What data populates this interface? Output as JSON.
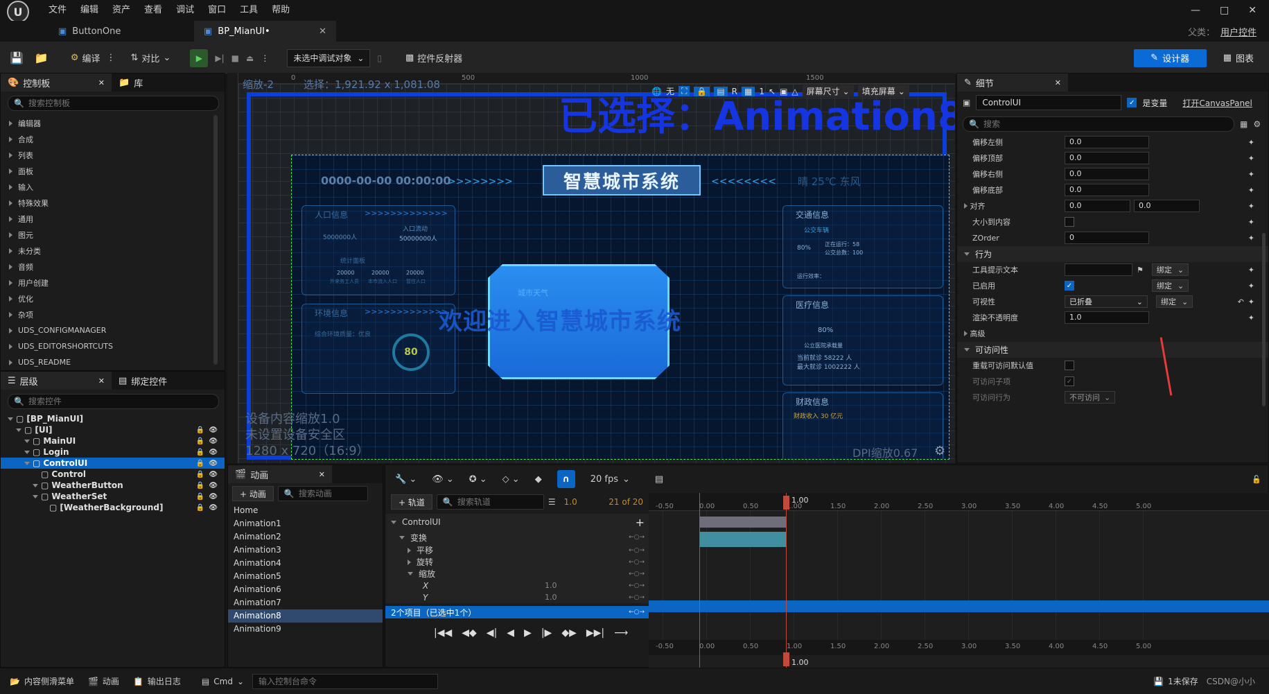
{
  "app": {
    "logo": "unreal-engine-logo"
  },
  "menu": [
    "文件",
    "编辑",
    "资产",
    "查看",
    "调试",
    "窗口",
    "工具",
    "帮助"
  ],
  "window": {
    "parent_label": "父类：",
    "parent_value": "用户控件"
  },
  "tabs": [
    {
      "label": "ButtonOne"
    },
    {
      "label": "BP_MianUI•"
    }
  ],
  "toolbar": {
    "compile": "编译",
    "diff": "对比",
    "debug_select": "未选中调试对象",
    "widget_reflector": "控件反射器",
    "designer": "设计器",
    "graph": "图表"
  },
  "palette": {
    "tab_palette": "控制板",
    "tab_library": "库",
    "search_placeholder": "搜索控制板",
    "items": [
      "编辑器",
      "合成",
      "列表",
      "面板",
      "输入",
      "特殊效果",
      "通用",
      "图元",
      "未分类",
      "音频",
      "用户创建",
      "优化",
      "杂项",
      "UDS_CONFIGMANAGER",
      "UDS_EDITORSHORTCUTS",
      "UDS_README"
    ]
  },
  "hierarchy": {
    "tab_hierarchy": "层级",
    "tab_bind": "绑定控件",
    "search_placeholder": "搜索控件",
    "items": [
      {
        "label": "[BP_MianUI]",
        "depth": 0
      },
      {
        "label": "[UI]",
        "depth": 1
      },
      {
        "label": "MainUI",
        "depth": 2
      },
      {
        "label": "Login",
        "depth": 2
      },
      {
        "label": "ControlUI",
        "depth": 2,
        "selected": true
      },
      {
        "label": "Control",
        "depth": 3
      },
      {
        "label": "WeatherButton",
        "depth": 3
      },
      {
        "label": "WeatherSet",
        "depth": 3
      },
      {
        "label": "[WeatherBackground]",
        "depth": 4
      }
    ]
  },
  "canvas": {
    "zoom": "缩放-2",
    "selection": "选择：1,921.92 x 1,081.08",
    "selected_banner": "已选择：Animation8",
    "ruler_marks": [
      "0",
      "500",
      "1000",
      "1500"
    ],
    "ruler_v_marks": [
      "0",
      "5",
      "5",
      "0"
    ],
    "device_scale": "设备内容缩放1.0",
    "safe_zone": "未设置设备安全区",
    "resolution": "1280 x 720（16:9）",
    "dpi": "DPI缩放0.67",
    "toolbar": {
      "none": "无",
      "r": "R",
      "one": "1",
      "screen_size": "屏幕尺寸",
      "fill_screen": "填充屏幕"
    },
    "ui_title": "智慧城市系统",
    "ui_datetime": "0000-00-00    00:00:00",
    "ui_weather": "晴    25℃    东风",
    "ui_welcome": "欢迎进入智慧城市系统",
    "ui_population": "人口信息",
    "ui_pop_daily": "入口流动",
    "ui_pop_total": "5000000人",
    "ui_pop_total2": "50000000人",
    "ui_pop_stats_title": "统计面板",
    "ui_pop_vals": [
      "20000",
      "20000",
      "20000"
    ],
    "ui_pop_labels": [
      "外来务工人员",
      "本市流入人口",
      "暂住人口"
    ],
    "ui_env": "环境信息",
    "ui_env_quality": "综合环境质量：优良",
    "ui_env_score": "80",
    "ui_traffic": "交通信息",
    "ui_traffic_bus": "公交车辆",
    "ui_traffic_running": "正在运行：58",
    "ui_traffic_total": "公交总数：100",
    "ui_traffic_pct": "80%",
    "ui_traffic_efficiency": "运行效率：",
    "ui_medical": "医疗信息",
    "ui_medical_hospital": "公立医院承载量",
    "ui_medical_current": "当前就诊 58222 人",
    "ui_medical_max": "最大就诊 1002222 人",
    "ui_medical_pct": "80%",
    "ui_finance": "财政信息",
    "ui_finance_income": "财政收入 30 亿元",
    "ui_center_btn": "城市天气"
  },
  "details": {
    "tab": "细节",
    "name": "ControlUI",
    "is_variable": "是变量",
    "open_canvas": "打开CanvasPanel",
    "search_placeholder": "搜索",
    "rows": [
      {
        "label": "偏移左侧",
        "value": "0.0"
      },
      {
        "label": "偏移顶部",
        "value": "0.0"
      },
      {
        "label": "偏移右侧",
        "value": "0.0"
      },
      {
        "label": "偏移底部",
        "value": "0.0"
      }
    ],
    "align_label": "对齐",
    "align_x": "0.0",
    "align_y": "0.0",
    "size_to_content": "大小到内容",
    "zorder_label": "ZOrder",
    "zorder": "0",
    "behavior": "行为",
    "tooltip": "工具提示文本",
    "bind": "绑定",
    "enabled": "已启用",
    "visibility": "可视性",
    "visibility_value": "已折叠",
    "opacity_label": "渲染不透明度",
    "opacity": "1.0",
    "advanced": "高级",
    "accessibility": "可访问性",
    "override_acc": "重载可访问默认值",
    "acc_children": "可访问子项",
    "acc_behavior": "可访问行为",
    "acc_behavior_value": "不可访问"
  },
  "animations": {
    "tab": "动画",
    "add": "+ 动画",
    "search_placeholder": "搜索动画",
    "items": [
      "Home",
      "Animation1",
      "Animation2",
      "Animation3",
      "Animation4",
      "Animation5",
      "Animation6",
      "Animation7",
      "Animation8",
      "Animation9"
    ],
    "selected": "Animation8"
  },
  "sequencer": {
    "fps": "20 fps",
    "add_track": "+ 轨道",
    "search_placeholder": "搜索轨道",
    "current_time": "1.0",
    "frame_info": "21 of 20",
    "playhead": "1.00",
    "tracks": [
      {
        "label": "ControlUI",
        "depth": 0
      },
      {
        "label": "变换",
        "depth": 1
      },
      {
        "label": "平移",
        "depth": 2
      },
      {
        "label": "旋转",
        "depth": 2
      },
      {
        "label": "缩放",
        "depth": 2
      },
      {
        "label": "X",
        "depth": 3,
        "value": "1.0"
      },
      {
        "label": "Y",
        "depth": 3,
        "value": "1.0"
      }
    ],
    "selection_summary": "2个项目（已选中1个）",
    "ticks": [
      "-0.50",
      "0.00",
      "0.50",
      "1.00",
      "1.50",
      "2.00",
      "2.50",
      "3.00",
      "3.50",
      "4.00",
      "4.50",
      "5.00"
    ]
  },
  "status": {
    "drawer": "内容侧滑菜单",
    "anim": "动画",
    "output_log": "输出日志",
    "cmd": "Cmd",
    "console_placeholder": "输入控制台命令",
    "unsaved": "1未保存",
    "version": "CSDN@小小"
  }
}
